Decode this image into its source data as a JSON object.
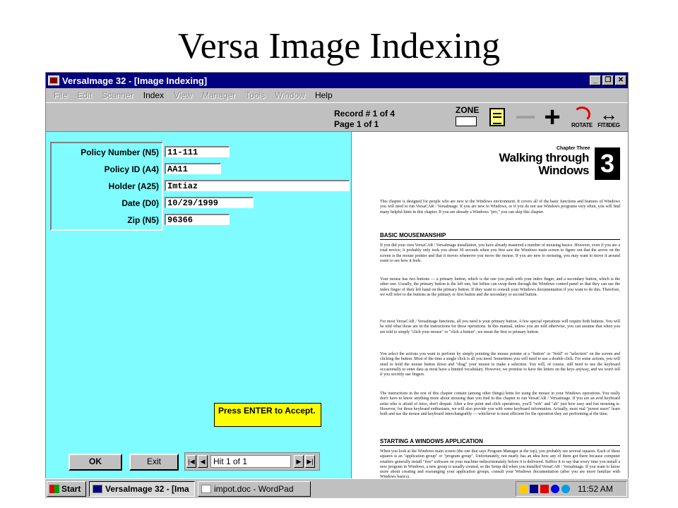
{
  "slide": {
    "title": "Versa Image Indexing"
  },
  "window": {
    "title": "VersaImage 32 - [Image Indexing]"
  },
  "menu": [
    {
      "label": "File",
      "enabled": false
    },
    {
      "label": "Edit",
      "enabled": false
    },
    {
      "label": "Scanner",
      "enabled": false
    },
    {
      "label": "Index",
      "enabled": true
    },
    {
      "label": "View",
      "enabled": false
    },
    {
      "label": "Manager",
      "enabled": false
    },
    {
      "label": "Tools",
      "enabled": false
    },
    {
      "label": "Window",
      "enabled": false
    },
    {
      "label": "Help",
      "enabled": true
    }
  ],
  "toolbar": {
    "record_info": "Record # 1 of 4",
    "page_info": "Page 1 of 1",
    "zone_label": "ZONE",
    "rotate_label": "ROTATE",
    "fit_label": "FIT/IDEG"
  },
  "index_form": {
    "fields": [
      {
        "label": "Policy Number (N5)",
        "value": "11-111"
      },
      {
        "label": "Policy ID (A4)",
        "value": "AA11"
      },
      {
        "label": "Holder (A25)",
        "value": "Imtiaz"
      },
      {
        "label": "Date (D0)",
        "value": "10/29/1999"
      },
      {
        "label": "Zip (N5)",
        "value": "96366"
      }
    ],
    "prompt": "Press ENTER to Accept.",
    "ok_label": "OK",
    "exit_label": "Exit",
    "nav_status": "Hit 1 of 1"
  },
  "document": {
    "chapter_label": "Chapter Three",
    "chapter_title_line1": "Walking through",
    "chapter_title_line2": "Windows",
    "chapter_number": "3",
    "intro": "This chapter is designed for people who are new to the Windows environment. It covers all of the basic functions and features of Windows you will need to run VersaCAR / VersaImage. If you are new to Windows, or if you do not use Windows programs very often, you will find many helpful hints in this chapter. If you are already a Windows \"pro,\" you can skip this chapter.",
    "heading1": "BASIC MOUSEMANSHIP",
    "para1": "If you did your own VersaCAR / VersaImage installation, you have already mastered a number of mousing basics. However, even if you are a total novice, it probably only took you about 30 seconds when you first saw the Windows main screen to figure out that the arrow on the screen is the mouse pointer and that it moves whenever you move the mouse. If you are new to mousing, you may want to move it around some to see how it feels.",
    "para2": "Your mouse has two buttons — a primary button, which is the one you push with your index finger, and a secondary button, which is the other one. Usually, the primary button is the left one, but lefties can swap them through the Windows control panel so that they can use the index finger of their left hand on the primary button. If they want to consult your Windows documentation if you want to do this. Therefore, we will refer to the buttons as the primary or first button and the secondary or second button.",
    "para3": "For most VersaCAR / VersaImage functions, all you need is your primary button. A few special operations will require both buttons. You will be told what those are in the instructions for those operations. In this manual, unless you are told otherwise, you can assume that when you are told to simply \"click your mouse\" or \"click a button\", we mean the first or primary button.",
    "para4": "You select the actions you want to perform by simply pointing the mouse pointer at a \"button\" or \"field\" or \"selection\" on the screen and clicking the button. Most of the time a single click is all you need. Sometimes you will need to use a double click. For some actions, you will need to hold the mouse button down and \"drag\" your mouse to make a selection. You will, of course, still need to use the keyboard occasionally to enter data as most have a limited vocabulary. However, we promise to have the letters on the keys anyway, and we won't tell if you secretly use fingers.",
    "para5": "The instructions in the rest of this chapter contain (among other things) hints for using the mouse in your Windows operations. You really don't have to know anything more about mousing than you find in this chapter to run VersaCAR / VersaImage. If you are an avid keyboard artist who is afraid of mice, don't despair. After a few point and click operations, you'll \"ooh\" and \"ah\" just how easy and fun mousing is. However, for those keyboard enthusiasts, we will also provide you with some keyboard information. Actually, most real \"power users\" learn both and use the mouse and keyboard interchangeably — whichever is most efficient for the operation they are performing at the time.",
    "heading2": "STARTING A WINDOWS APPLICATION",
    "para6": "When you look at the Windows main screen (the one that says Program Manager at the top), you probably see several squares. Each of these squares is an \"application group\" or \"program group\". Unfortunately, not nearly has an idea how any of them got there because computer retailers generally install \"free\" software on your machine indiscriminately before it is delivered. Suffice it to say that every time you install a new program in Windows, a new group is usually created, so the Setup did when you installed VersaCAR / VersaImage. If you want to know more about creating and rearranging your application groups, consult your Windows documentation (after you are more familiar with Windows basics)."
  },
  "taskbar": {
    "start_label": "Start",
    "tasks": [
      {
        "label": "VersaImage 32 - [Ima",
        "active": true
      },
      {
        "label": "impot.doc - WordPad",
        "active": false
      }
    ],
    "clock": "11:52 AM"
  },
  "colors": {
    "title_bar": "#000080",
    "form_background": "#7ffcff",
    "prompt_background": "#ffff00",
    "window_chrome": "#c0c0c0"
  }
}
